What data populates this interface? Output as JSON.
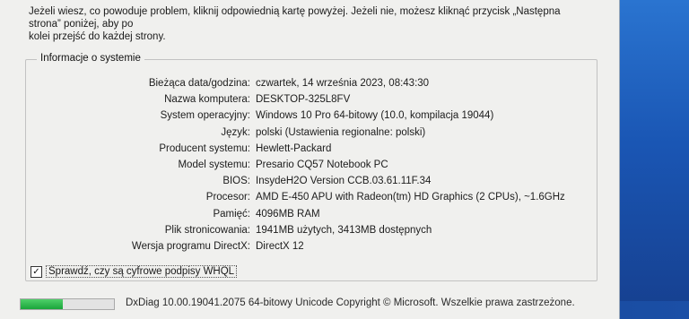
{
  "header": {
    "instruction_line1": "Jeżeli wiesz, co powoduje problem, kliknij odpowiednią kartę powyżej. Jeżeli nie, możesz kliknąć przycisk „Następna strona” poniżej, aby po",
    "instruction_line2": "kolei przejść do każdej strony."
  },
  "system_info": {
    "group_title": "Informacje o systemie",
    "rows": [
      {
        "label": "Bieżąca data/godzina:",
        "value": "czwartek, 14 września 2023, 08:43:30"
      },
      {
        "label": "Nazwa komputera:",
        "value": "DESKTOP-325L8FV"
      },
      {
        "label": "System operacyjny:",
        "value": "Windows 10 Pro 64-bitowy (10.0, kompilacja 19044)"
      },
      {
        "label": "Język:",
        "value": "polski (Ustawienia regionalne: polski)"
      },
      {
        "label": "Producent systemu:",
        "value": "Hewlett-Packard"
      },
      {
        "label": "Model systemu:",
        "value": "Presario CQ57 Notebook PC"
      },
      {
        "label": "BIOS:",
        "value": "InsydeH2O Version CCB.03.61.11F.34"
      },
      {
        "label": "Procesor:",
        "value": "AMD E-450 APU with Radeon(tm) HD Graphics (2 CPUs), ~1.6GHz"
      },
      {
        "label": "Pamięć:",
        "value": "4096MB RAM"
      },
      {
        "label": "Plik stronicowania:",
        "value": "1941MB użytych, 3413MB dostępnych"
      },
      {
        "label": "Wersja programu DirectX:",
        "value": "DirectX 12"
      }
    ]
  },
  "whql": {
    "label": "Sprawdź, czy są cyfrowe podpisy WHQL",
    "checked": true,
    "check_glyph": "✓"
  },
  "footer": {
    "progress": 0.45,
    "text": "DxDiag 10.00.19041.2075 64-bitowy Unicode  Copyright © Microsoft. Wszelkie prawa zastrzeżone."
  }
}
